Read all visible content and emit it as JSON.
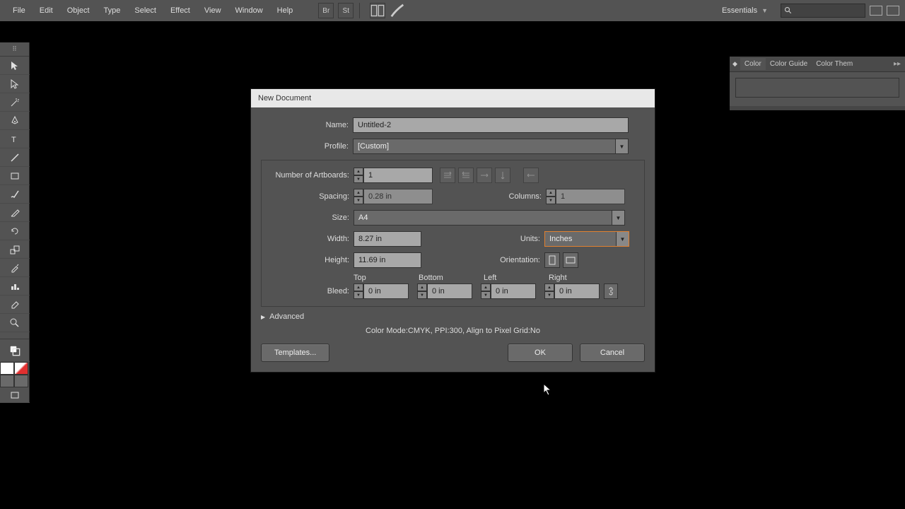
{
  "menu": {
    "items": [
      "File",
      "Edit",
      "Object",
      "Type",
      "Select",
      "Effect",
      "View",
      "Window",
      "Help"
    ],
    "workspace": "Essentials"
  },
  "panels": {
    "tabs": [
      "Color",
      "Color Guide",
      "Color Them"
    ]
  },
  "dialog": {
    "title": "New Document",
    "name_label": "Name:",
    "name_value": "Untitled-2",
    "profile_label": "Profile:",
    "profile_value": "[Custom]",
    "artboards_label": "Number of Artboards:",
    "artboards_value": "1",
    "spacing_label": "Spacing:",
    "spacing_value": "0.28 in",
    "columns_label": "Columns:",
    "columns_value": "1",
    "size_label": "Size:",
    "size_value": "A4",
    "width_label": "Width:",
    "width_value": "8.27 in",
    "height_label": "Height:",
    "height_value": "11.69 in",
    "units_label": "Units:",
    "units_value": "Inches",
    "orientation_label": "Orientation:",
    "bleed_label": "Bleed:",
    "bleed_headers": {
      "top": "Top",
      "bottom": "Bottom",
      "left": "Left",
      "right": "Right"
    },
    "bleed_values": {
      "top": "0 in",
      "bottom": "0 in",
      "left": "0 in",
      "right": "0 in"
    },
    "advanced_label": "Advanced",
    "info_text": "Color Mode:CMYK, PPI:300, Align to Pixel Grid:No",
    "templates_btn": "Templates...",
    "ok_btn": "OK",
    "cancel_btn": "Cancel"
  }
}
